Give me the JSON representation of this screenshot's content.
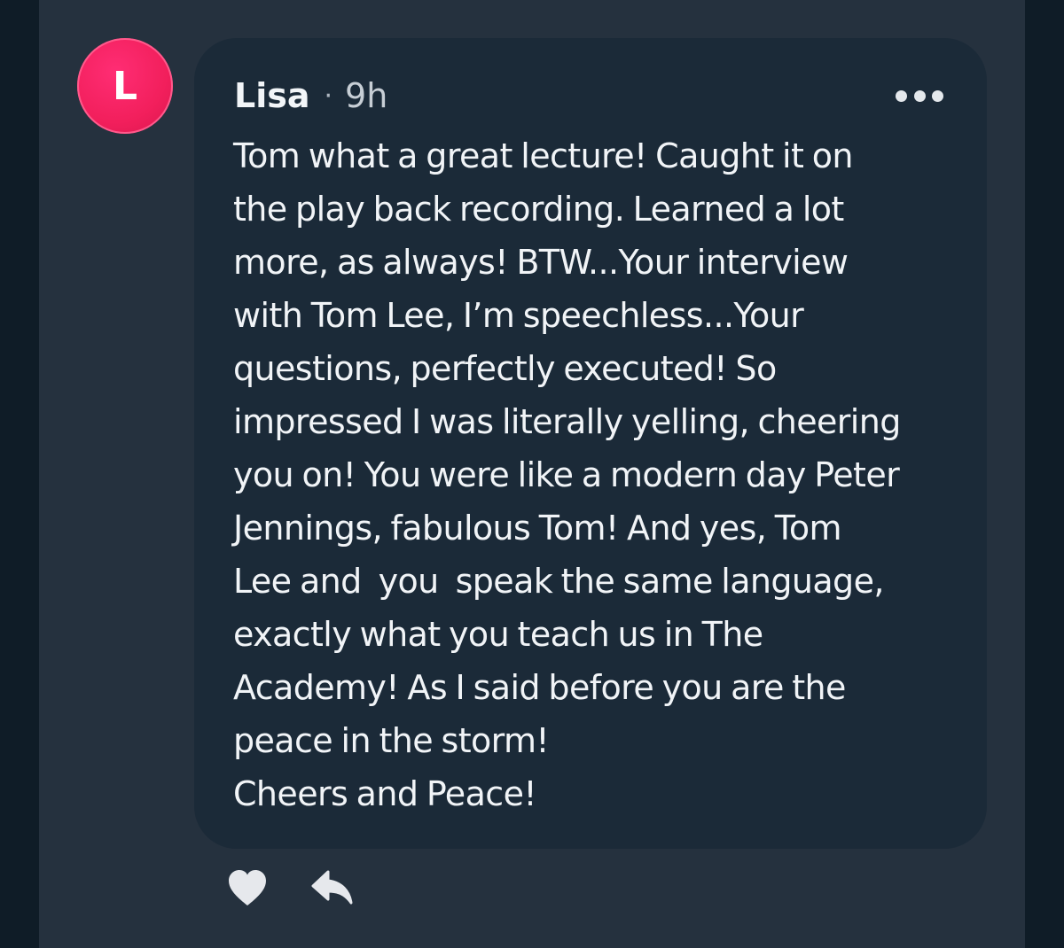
{
  "comment": {
    "avatar_initial": "L",
    "author": "Lisa",
    "separator": "·",
    "time": "9h",
    "text": "Tom what a great lecture! Caught it on\nthe play back recording. Learned a lot\nmore, as always! BTW...Your interview\nwith Tom Lee, I’m speechless...Your\nquestions, perfectly executed! So\nimpressed I was literally yelling, cheering\nyou on! You were like a modern day Peter\nJennings, fabulous Tom! And yes, Tom\nLee and  you  speak the same language,\nexactly what you teach us in The\nAcademy! As I said before you are the\npeace in the storm!\nCheers and Peace!"
  },
  "icons": {
    "more": "more-horizontal-icon",
    "like": "heart-icon",
    "reply": "reply-arrow-icon"
  },
  "colors": {
    "avatar": "#f21f5c",
    "bubble": "#1b2a38",
    "panel": "#25313e",
    "background": "#0f1c27"
  }
}
